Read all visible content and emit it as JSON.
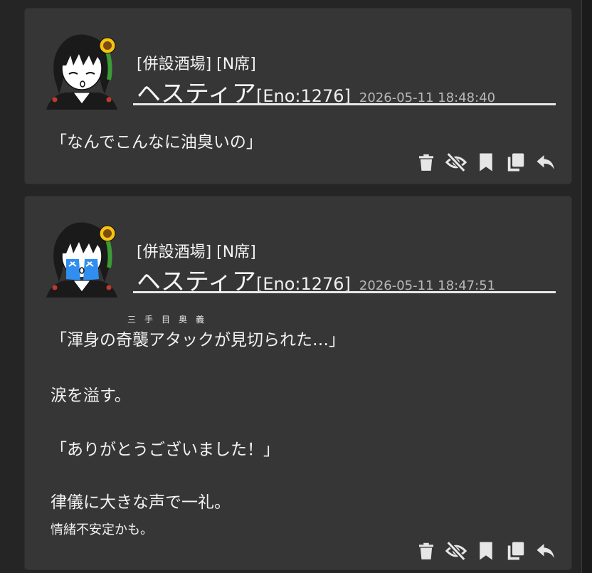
{
  "posts": [
    {
      "place": "[併設酒場] [N席]",
      "name": "ヘスティア",
      "eno": "[Eno:1276]",
      "time": "2026-05-11 18:48:40",
      "lines": [
        "「なんでこんなに油臭いの」"
      ],
      "avatar": "sleepy-face"
    },
    {
      "place": "[併設酒場] [N席]",
      "name": "ヘスティア",
      "eno": "[Eno:1276]",
      "time": "2026-05-11 18:47:51",
      "ruby": "三手目奥義",
      "lines": [
        "「渾身の奇襲アタックが見切られた…」",
        "涙を溢す。",
        "「ありがとうございました！」",
        "律儀に大きな声で一礼。"
      ],
      "note": "情緒不安定かも。",
      "avatar": "crying-face"
    }
  ],
  "actions": [
    "trash-icon",
    "hide-icon",
    "bookmark-icon",
    "copy-icon",
    "reply-icon"
  ],
  "colors": {
    "background": "#252525",
    "card": "#363636",
    "text": "#f2f2f2",
    "muted": "#b8b8b8",
    "accent_tears": "#2f8ef0",
    "sunflower": "#f5c40f"
  }
}
